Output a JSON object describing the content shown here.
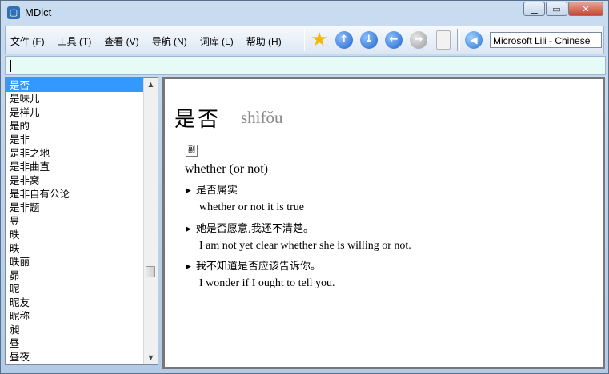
{
  "window": {
    "title": "MDict"
  },
  "menu": [
    "文件 (F)",
    "工具 (T)",
    "查看 (V)",
    "导航 (N)",
    "词库 (L)",
    "帮助 (H)"
  ],
  "voice": {
    "selected": "Microsoft Lili - Chinese"
  },
  "wordlist": {
    "items": [
      "是否",
      "是味儿",
      "是样儿",
      "是的",
      "是非",
      "是非之地",
      "是非曲直",
      "是非窝",
      "是非自有公论",
      "是非题",
      "昱",
      "昳",
      "昳",
      "昳丽",
      "昴",
      "昵",
      "昵友",
      "昵称",
      "昶",
      "昼",
      "昼夜"
    ],
    "selected_index": 0
  },
  "entry": {
    "headword": "是否",
    "pinyin": "shìfǒu",
    "pos_tag": "副",
    "definition": "whether (or not)",
    "examples": [
      {
        "cn": "是否属实",
        "en": "whether or not it is true"
      },
      {
        "cn": "她是否愿意,我还不清楚。",
        "en": "I am not yet clear whether she is willing or not."
      },
      {
        "cn": "我不知道是否应该告诉你。",
        "en": "I wonder if I ought to tell you."
      }
    ]
  }
}
